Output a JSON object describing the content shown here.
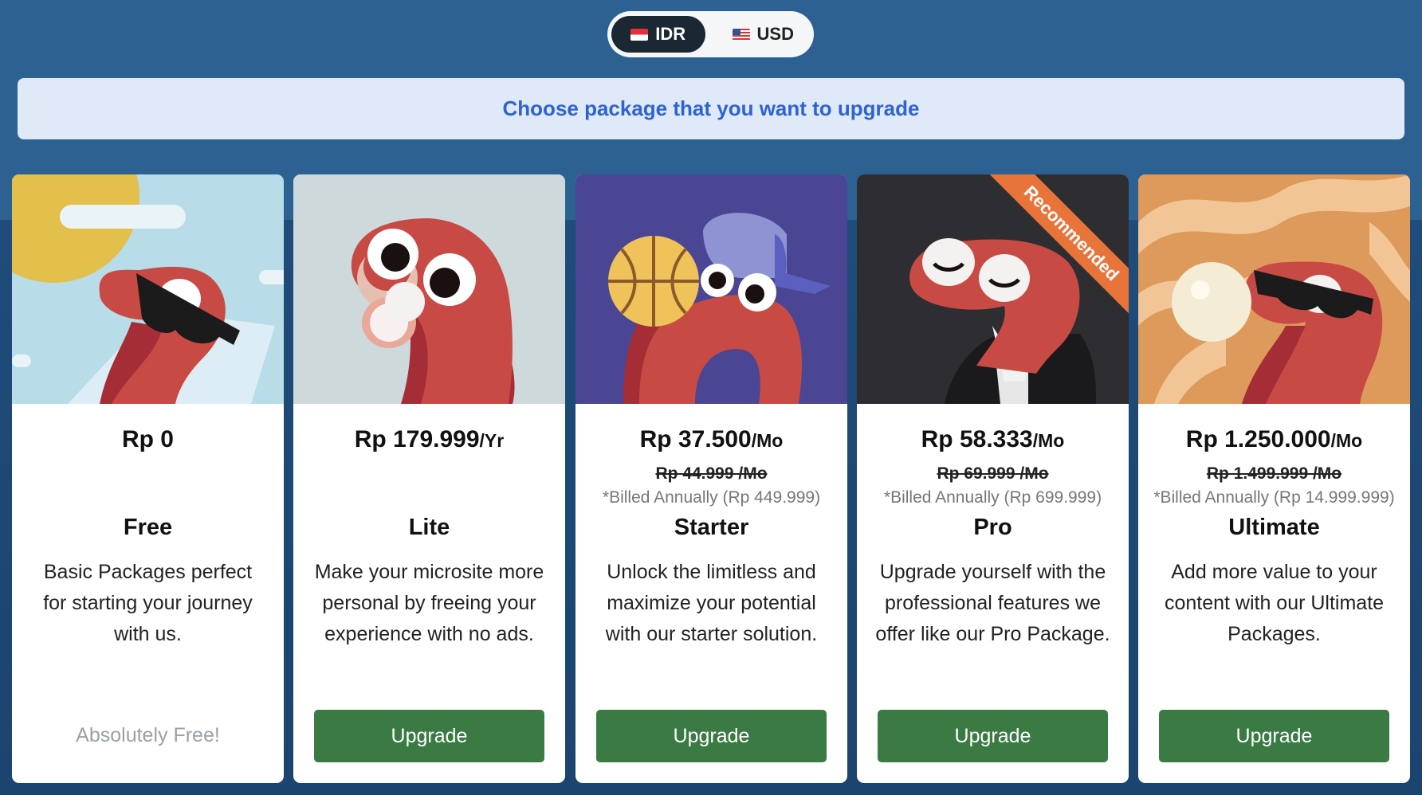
{
  "currency": {
    "options": [
      {
        "label": "IDR",
        "flag": "indonesia-flag-icon",
        "selected": true
      },
      {
        "label": "USD",
        "flag": "us-flag-icon",
        "selected": false
      }
    ]
  },
  "banner": {
    "text": "Choose package that you want to upgrade"
  },
  "plans": [
    {
      "price": "Rp 0",
      "unit": "",
      "old_price": "",
      "billed": "",
      "name": "Free",
      "description": "Basic Packages perfect for starting your journey with us.",
      "action_type": "note",
      "note": "Absolutely Free!",
      "illustration": "snake-sunglasses-sky"
    },
    {
      "price": "Rp 179.999",
      "unit": "/Yr",
      "old_price": "",
      "billed": "",
      "name": "Lite",
      "description": "Make your microsite more personal by freeing your experience with no ads.",
      "action_type": "button",
      "button_label": "Upgrade",
      "illustration": "snake-pacifier"
    },
    {
      "price": "Rp 37.500",
      "unit": "/Mo",
      "old_price": "Rp 44.999 /Mo",
      "billed": "*Billed Annually (Rp 449.999)",
      "name": "Starter",
      "description": "Unlock the limitless and maximize your potential with our starter solution.",
      "action_type": "button",
      "button_label": "Upgrade",
      "illustration": "snake-basketball-cap"
    },
    {
      "price": "Rp 58.333",
      "unit": "/Mo",
      "old_price": "Rp 69.999 /Mo",
      "billed": "*Billed Annually (Rp 699.999)",
      "name": "Pro",
      "description": "Upgrade yourself with the professional features we offer like our Pro Package.",
      "action_type": "button",
      "button_label": "Upgrade",
      "badge": "Recommended",
      "illustration": "snake-tuxedo"
    },
    {
      "price": "Rp 1.250.000",
      "unit": "/Mo",
      "old_price": "Rp 1.499.999 /Mo",
      "billed": "*Billed Annually (Rp 14.999.999)",
      "name": "Ultimate",
      "description": "Add more value to your content with our Ultimate Packages.",
      "action_type": "button",
      "button_label": "Upgrade",
      "illustration": "snake-pearl-sunglasses"
    }
  ],
  "colors": {
    "page_bg": "#2c6192",
    "banner_bg": "#dfe9f8",
    "banner_text": "#2f63d1",
    "button": "#3a7b44",
    "ribbon": "#e9743a",
    "toggle_active": "#1a2833"
  }
}
